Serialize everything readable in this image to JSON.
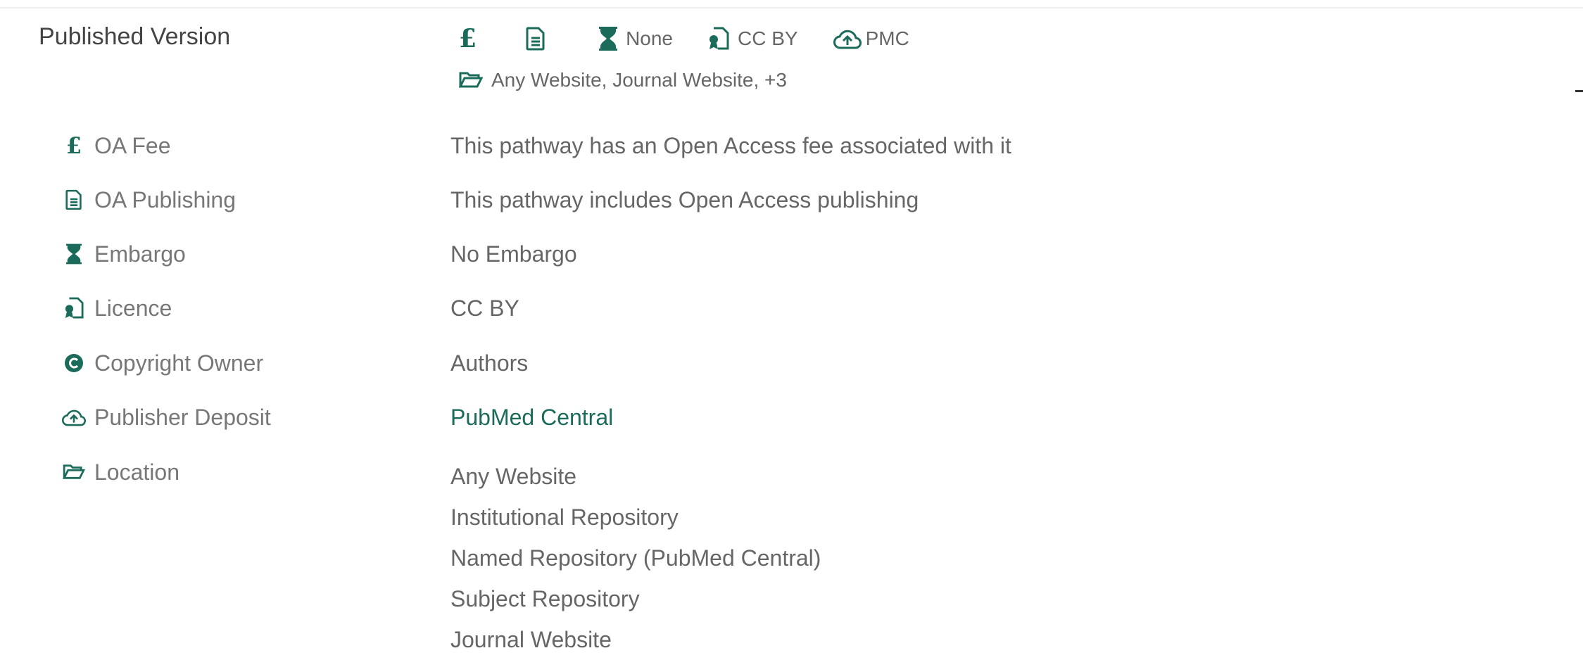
{
  "section": {
    "title": "Published Version"
  },
  "summary": {
    "fee_icon": "pound-icon",
    "publishing_icon": "document-icon",
    "embargo_icon": "hourglass-icon",
    "embargo_text": "None",
    "licence_icon": "licence-icon",
    "licence_text": "CC BY",
    "deposit_icon": "cloud-upload-icon",
    "deposit_text": "PMC",
    "location_icon": "folder-open-icon",
    "location_text": "Any Website, Journal Website, +3"
  },
  "details": {
    "oa_fee": {
      "label": "OA Fee",
      "value": "This pathway has an Open Access fee associated with it"
    },
    "oa_publishing": {
      "label": "OA Publishing",
      "value": "This pathway includes Open Access publishing"
    },
    "embargo": {
      "label": "Embargo",
      "value": "No Embargo"
    },
    "licence": {
      "label": "Licence",
      "value": "CC BY"
    },
    "copyright": {
      "label": "Copyright Owner",
      "value": "Authors"
    },
    "deposit": {
      "label": "Publisher Deposit",
      "value": "PubMed Central"
    },
    "location": {
      "label": "Location",
      "items": [
        "Any Website",
        "Institutional Repository",
        "Named Repository (PubMed Central)",
        "Subject Repository",
        "Journal Website"
      ]
    }
  },
  "colors": {
    "accent": "#1b6b5a",
    "text": "#666666",
    "label": "#777777"
  }
}
